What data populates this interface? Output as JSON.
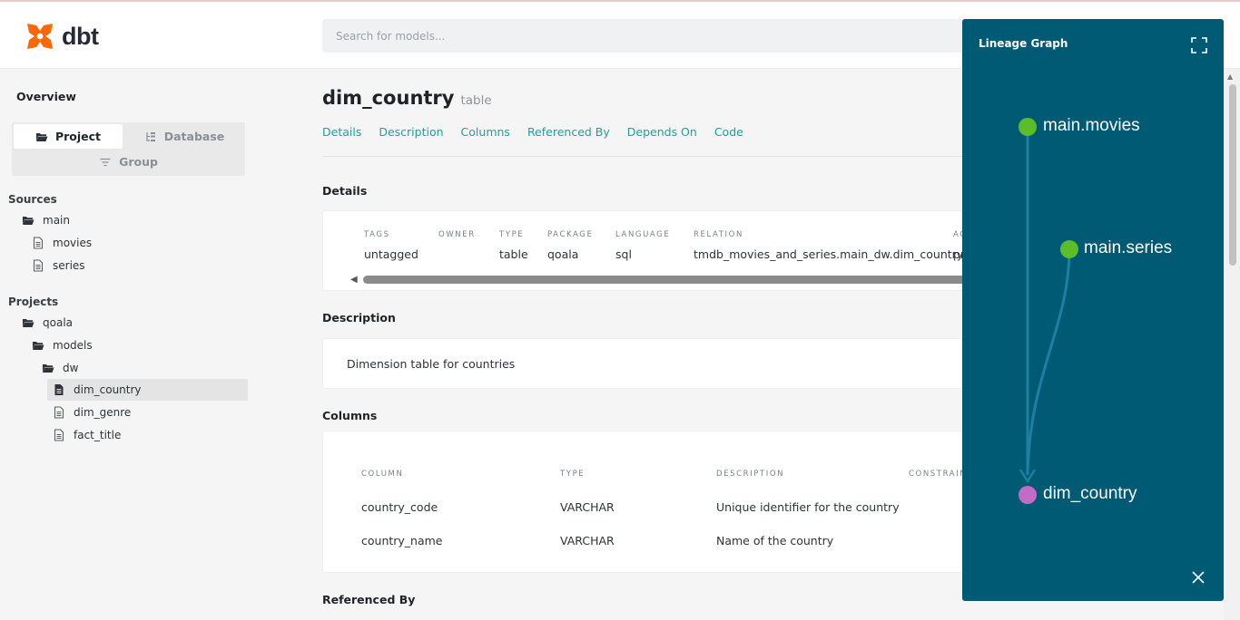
{
  "brand": {
    "name": "dbt",
    "color": "#fe6703"
  },
  "search": {
    "placeholder": "Search for models..."
  },
  "sidebar": {
    "overview": "Overview",
    "toggle": {
      "project": "Project",
      "database": "Database",
      "group": "Group"
    },
    "sources_title": "Sources",
    "sources": [
      {
        "label": "main",
        "icon": "folder-open-icon"
      },
      {
        "label": "movies",
        "icon": "file-icon"
      },
      {
        "label": "series",
        "icon": "file-icon"
      }
    ],
    "projects_title": "Projects",
    "projects": [
      {
        "label": "qoala",
        "icon": "folder-open-icon"
      },
      {
        "label": "models",
        "icon": "folder-open-icon"
      },
      {
        "label": "dw",
        "icon": "folder-open-icon"
      },
      {
        "label": "dim_country",
        "icon": "file-icon",
        "active": true
      },
      {
        "label": "dim_genre",
        "icon": "file-icon"
      },
      {
        "label": "fact_title",
        "icon": "file-icon"
      }
    ]
  },
  "model": {
    "name": "dim_country",
    "type": "table",
    "tabs": [
      "Details",
      "Description",
      "Columns",
      "Referenced By",
      "Depends On",
      "Code"
    ]
  },
  "details": {
    "heading": "Details",
    "fields": [
      {
        "key": "TAGS",
        "value": "untagged"
      },
      {
        "key": "OWNER",
        "value": ""
      },
      {
        "key": "TYPE",
        "value": "table"
      },
      {
        "key": "PACKAGE",
        "value": "qoala"
      },
      {
        "key": "LANGUAGE",
        "value": "sql"
      },
      {
        "key": "RELATION",
        "value": "tmdb_movies_and_series.main_dw.dim_country"
      },
      {
        "key": "AC",
        "value": "pr"
      }
    ]
  },
  "description": {
    "heading": "Description",
    "text": "Dimension table for countries"
  },
  "columns": {
    "heading": "Columns",
    "headers": [
      "COLUMN",
      "TYPE",
      "DESCRIPTION",
      "CONSTRAIN"
    ],
    "rows": [
      [
        "country_code",
        "VARCHAR",
        "Unique identifier for the country"
      ],
      [
        "country_name",
        "VARCHAR",
        "Name of the country"
      ]
    ]
  },
  "referenced_by": {
    "heading": "Referenced By"
  },
  "lineage": {
    "title": "Lineage Graph",
    "nodes": [
      {
        "label": "main.movies",
        "kind": "source",
        "color": "#5cbd2a"
      },
      {
        "label": "main.series",
        "kind": "source",
        "color": "#5cbd2a"
      },
      {
        "label": "dim_country",
        "kind": "model",
        "color": "#c26bc7"
      }
    ],
    "panel_color": "#005a74",
    "edge_color": "#1e7fa3"
  }
}
